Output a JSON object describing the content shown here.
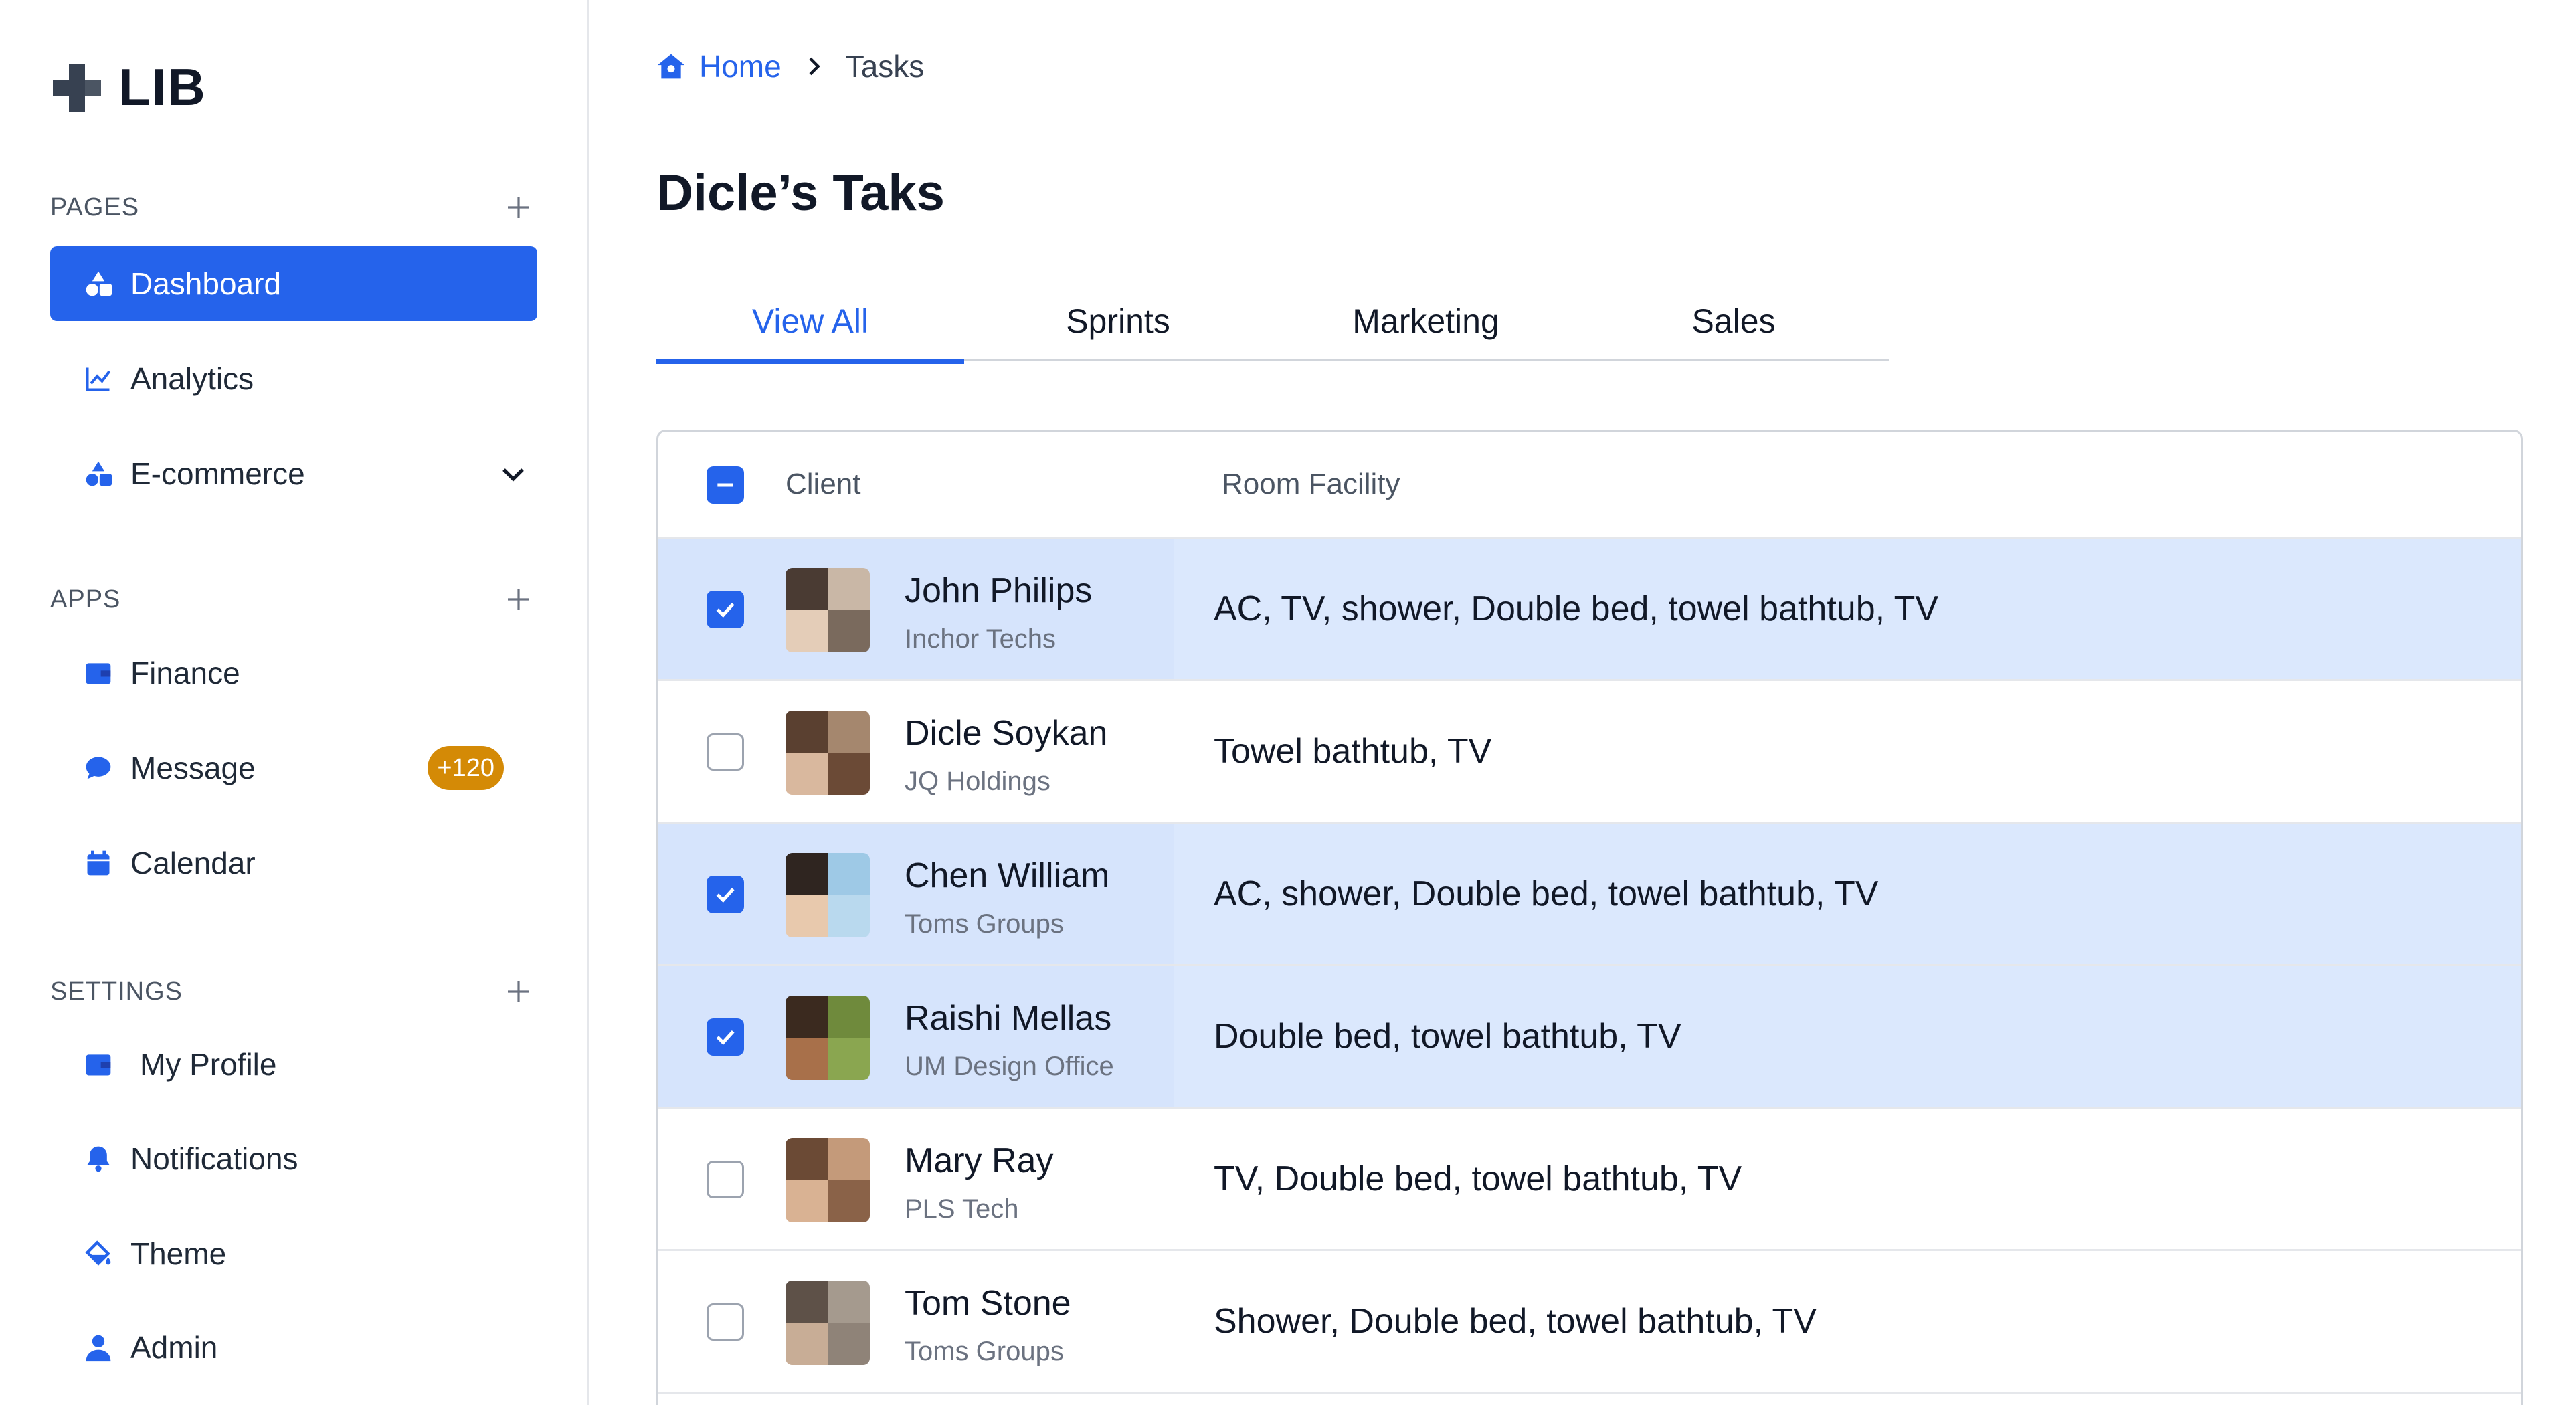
{
  "logo": {
    "text": "LIB"
  },
  "sidebar": {
    "sections": [
      {
        "title": "PAGES",
        "items": [
          {
            "label": "Dashboard",
            "icon": "shapes-icon",
            "active": true
          },
          {
            "label": "Analytics",
            "icon": "chart-line-icon"
          },
          {
            "label": "E-commerce",
            "icon": "shapes-icon",
            "expandable": true
          }
        ]
      },
      {
        "title": "APPS",
        "items": [
          {
            "label": "Finance",
            "icon": "wallet-icon"
          },
          {
            "label": "Message",
            "icon": "chat-icon",
            "badge": "+120"
          },
          {
            "label": "Calendar",
            "icon": "calendar-icon"
          }
        ]
      },
      {
        "title": "SETTINGS",
        "items": [
          {
            "label": "My Profile",
            "icon": "wallet-icon"
          },
          {
            "label": "Notifications",
            "icon": "bell-icon"
          },
          {
            "label": "Theme",
            "icon": "paint-bucket-icon"
          },
          {
            "label": "Admin",
            "icon": "user-icon"
          }
        ]
      }
    ]
  },
  "breadcrumb": {
    "home": "Home",
    "current": "Tasks"
  },
  "page": {
    "title": "Dicle’s Taks"
  },
  "tabs": [
    {
      "label": "View All",
      "active": true
    },
    {
      "label": "Sprints"
    },
    {
      "label": "Marketing"
    },
    {
      "label": "Sales"
    }
  ],
  "table": {
    "columns": {
      "client": "Client",
      "facility": "Room Facility"
    },
    "header_checkbox": "indeterminate",
    "rows": [
      {
        "name": "John Philips",
        "company": "Inchor Techs",
        "facility": "AC, TV, shower, Double bed, towel bathtub, TV",
        "checked": true
      },
      {
        "name": "Dicle Soykan",
        "company": "JQ Holdings",
        "facility": "Towel bathtub, TV",
        "checked": false
      },
      {
        "name": "Chen William",
        "company": "Toms Groups",
        "facility": "AC, shower, Double bed, towel bathtub, TV",
        "checked": true
      },
      {
        "name": "Raishi Mellas",
        "company": "UM Design Office",
        "facility": "Double bed, towel bathtub, TV",
        "checked": true
      },
      {
        "name": "Mary Ray",
        "company": "PLS Tech",
        "facility": "TV, Double bed, towel bathtub, TV",
        "checked": false
      },
      {
        "name": "Tom Stone",
        "company": "Toms Groups",
        "facility": "Shower, Double bed, towel bathtub, TV",
        "checked": false
      }
    ]
  },
  "colors": {
    "accent": "#2563eb",
    "selected_row": "#dbe8fd",
    "badge": "#d48a06"
  }
}
